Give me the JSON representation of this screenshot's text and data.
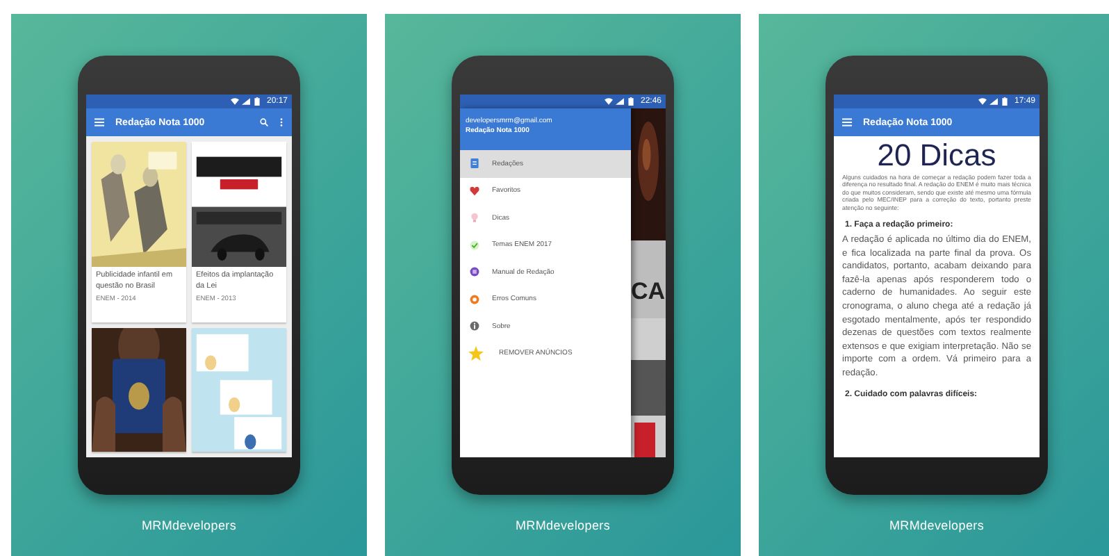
{
  "panels": [
    {
      "kind": "grid",
      "status": {
        "time": "20:17"
      },
      "app_bar": {
        "title": "Redação Nota 1000",
        "has_actions": true
      },
      "cards": [
        {
          "kind": "article",
          "title": "Publicidade infantil em questão no Brasil",
          "meta": "ENEM - 2014"
        },
        {
          "kind": "article",
          "title": "Efeitos da implantação da Lei",
          "meta": "ENEM - 2013"
        },
        {
          "kind": "picture"
        },
        {
          "kind": "picture"
        }
      ],
      "caption": "MRMdevelopers"
    },
    {
      "kind": "drawer",
      "status": {
        "time": "22:46"
      },
      "drawer": {
        "email": "developersmrm@gmail.com",
        "title": "Redação Nota 1000",
        "items": [
          {
            "label": "Redações",
            "kind": "nav",
            "selected": true
          },
          {
            "label": "Favoritos",
            "kind": "nav",
            "selected": false
          },
          {
            "label": "Dicas",
            "kind": "nav",
            "selected": false
          },
          {
            "label": "Temas ENEM 2017",
            "kind": "nav",
            "selected": false
          },
          {
            "label": "Manual de Redação",
            "kind": "nav",
            "selected": false
          },
          {
            "label": "Erros Comuns",
            "kind": "nav",
            "selected": false
          },
          {
            "label": "Sobre",
            "kind": "nav",
            "selected": false
          },
          {
            "label": "REMOVER ANÚNCIOS",
            "kind": "action",
            "selected": false
          }
        ]
      },
      "behind_text": "CA",
      "caption": "MRMdevelopers"
    },
    {
      "kind": "article",
      "status": {
        "time": "17:49"
      },
      "app_bar": {
        "title": "Redação Nota 1000",
        "has_actions": false
      },
      "article": {
        "heading": "20 Dicas",
        "intro": "Alguns cuidados na hora de começar a redação podem fazer toda a diferença no resultado final. A redação do ENEM é muito mais técnica do que muitos consideram, sendo que existe até mesmo uma fórmula criada pelo MEC/INEP para a correção do texto, portanto preste atenção no seguinte:",
        "sections": [
          {
            "title": "1. Faça a redação primeiro:",
            "body": "A redação é aplicada no último dia do ENEM, e fica localizada na parte final da prova. Os candidatos, portanto, acabam deixando para fazê-la apenas após responderem todo o caderno de humanidades. Ao seguir este cronograma, o aluno chega até a redação já esgotado mentalmente, após ter respondido dezenas de questões com textos realmente extensos e que exigiam interpretação. Não se importe com a ordem. Vá primeiro para a redação."
          },
          {
            "title": "2. Cuidado com palavras difíceis:"
          }
        ]
      },
      "caption": "MRMdevelopers"
    }
  ]
}
